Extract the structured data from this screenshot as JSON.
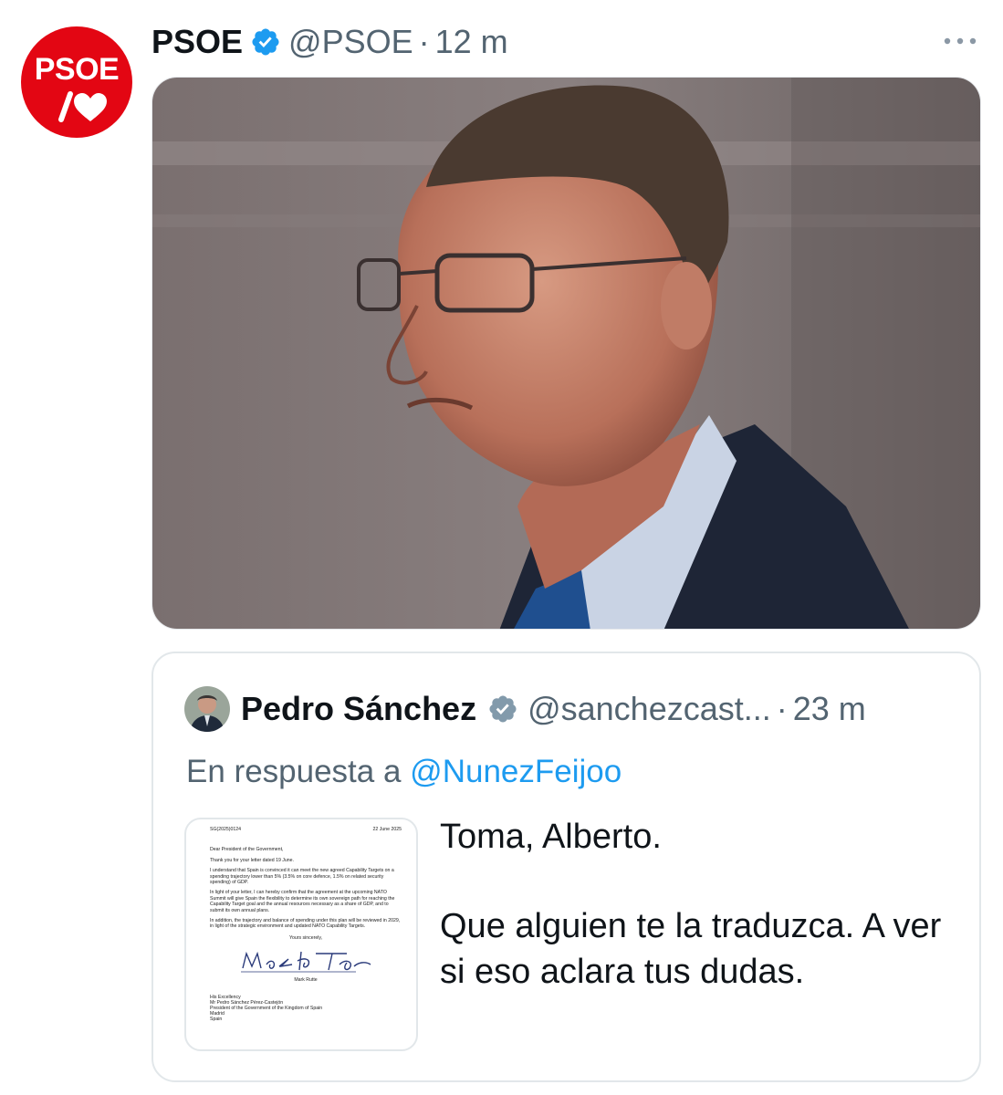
{
  "tweet": {
    "avatar": {
      "label": "PSOE",
      "icon": "psoe-logo-icon",
      "color": "#e30613"
    },
    "author_name": "PSOE",
    "handle": "@PSOE",
    "separator": "·",
    "time": "12 m",
    "more_icon": "more-dots-icon",
    "photo": {
      "icon": "photo-image"
    }
  },
  "quote": {
    "author_name": "Pedro Sánchez",
    "handle": "@sanchezcast...",
    "separator": "·",
    "time": "23 m",
    "reply_prefix": "En respuesta a",
    "reply_mention": "@NunezFeijoo",
    "text_line1": "Toma, Alberto.",
    "text_line2": "Que alguien te la traduzca. A ver si eso aclara tus dudas.",
    "document": {
      "ref": "SG(2025)0124",
      "date": "22 June 2025",
      "salutation": "Dear President of the Government,",
      "p1": "Thank you for your letter dated 19 June.",
      "p2": "I understand that Spain is convinced it can meet the new agreed Capability Targets on a spending trajectory lower than 5% (3.5% on core defence, 1.5% on related security spending) of GDP.",
      "p3": "In light of your letter, I can hereby confirm that the agreement at the upcoming NATO Summit will give Spain the flexibility to determine its own sovereign path for reaching the Capability Target goal and the annual resources necessary as a share of GDP, and to submit its own annual plans.",
      "p4": "In addition, the trajectory and balance of spending under this plan will be reviewed in 2029, in light of the strategic environment and updated NATO Capability Targets.",
      "closing": "Yours sincerely,",
      "signer": "Mark Rutte",
      "addr1": "His Excellency",
      "addr2": "Mr Pedro Sánchez Pérez-Castejón",
      "addr3": "President of the Government of the Kingdom of Spain",
      "addr4": "Madrid",
      "addr5": "Spain"
    }
  },
  "colors": {
    "blue": "#1d9bf0",
    "secondary": "#536471",
    "text": "#0f1419",
    "border": "#e2e7ea"
  }
}
